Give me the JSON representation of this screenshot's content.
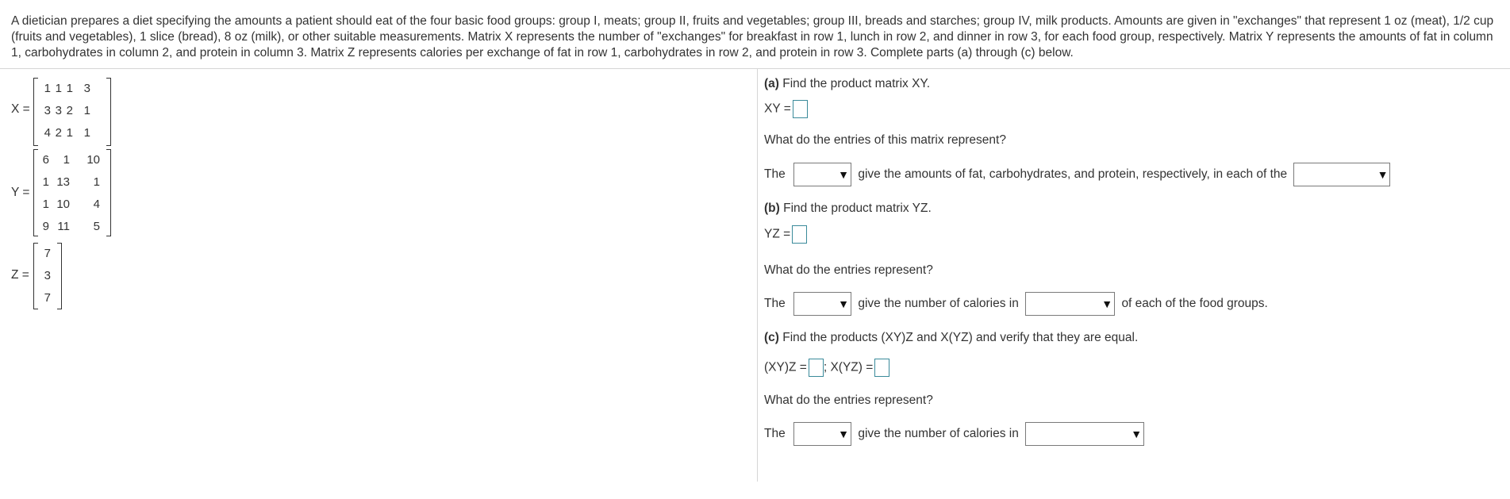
{
  "problem": {
    "text": "A dietician prepares a diet specifying the amounts a patient should eat of the four basic food groups: group I, meats; group II, fruits and vegetables; group III, breads and starches; group IV, milk products. Amounts are given in \"exchanges\" that represent 1 oz (meat), 1/2 cup (fruits and vegetables), 1 slice (bread), 8 oz (milk), or other suitable measurements. Matrix X represents the number of \"exchanges\" for breakfast in row 1, lunch in row 2, and dinner in row 3, for each food group, respectively. Matrix Y represents the amounts of fat in column 1, carbohydrates in column 2, and protein in column 3. Matrix Z represents calories per exchange of fat in row 1, carbohydrates in row 2, and protein in row 3. Complete parts (a) through (c) below."
  },
  "matrices": {
    "X": {
      "label": "X =",
      "rows": [
        [
          "1",
          "1",
          "1",
          "3"
        ],
        [
          "3",
          "3",
          "2",
          "1"
        ],
        [
          "4",
          "2",
          "1",
          "1"
        ]
      ]
    },
    "Y": {
      "label": "Y =",
      "rows": [
        [
          "6",
          "1",
          "10"
        ],
        [
          "1",
          "13",
          "1"
        ],
        [
          "1",
          "10",
          "4"
        ],
        [
          "9",
          "11",
          "5"
        ]
      ]
    },
    "Z": {
      "label": "Z =",
      "rows": [
        [
          "7"
        ],
        [
          "3"
        ],
        [
          "7"
        ]
      ]
    }
  },
  "part_a": {
    "heading_bold": "(a)",
    "heading_text": " Find the product matrix XY.",
    "answer_label": "XY =",
    "question": "What do the entries of this matrix represent?",
    "sentence_start": "The",
    "sentence_mid": "give the amounts of fat, carbohydrates, and protein, respectively, in each of the",
    "dropdown1_value": "",
    "dropdown2_value": ""
  },
  "part_b": {
    "heading_bold": "(b)",
    "heading_text": " Find the product matrix YZ.",
    "answer_label": "YZ =",
    "question": "What do the entries represent?",
    "sentence_start": "The",
    "sentence_mid": "give the number of calories in",
    "sentence_end": "of each of the food groups.",
    "dropdown1_value": "",
    "dropdown2_value": ""
  },
  "part_c": {
    "heading_bold": "(c)",
    "heading_text": " Find the products (XY)Z and X(YZ) and verify that they are equal.",
    "answer_label1": "(XY)Z =",
    "separator": ";",
    "answer_label2": "X(YZ) =",
    "question": "What do the entries represent?",
    "sentence_start": "The",
    "sentence_mid": "give the number of calories in",
    "dropdown1_value": "",
    "dropdown2_value": ""
  },
  "icons": {
    "dropdown_arrow": "▼"
  }
}
